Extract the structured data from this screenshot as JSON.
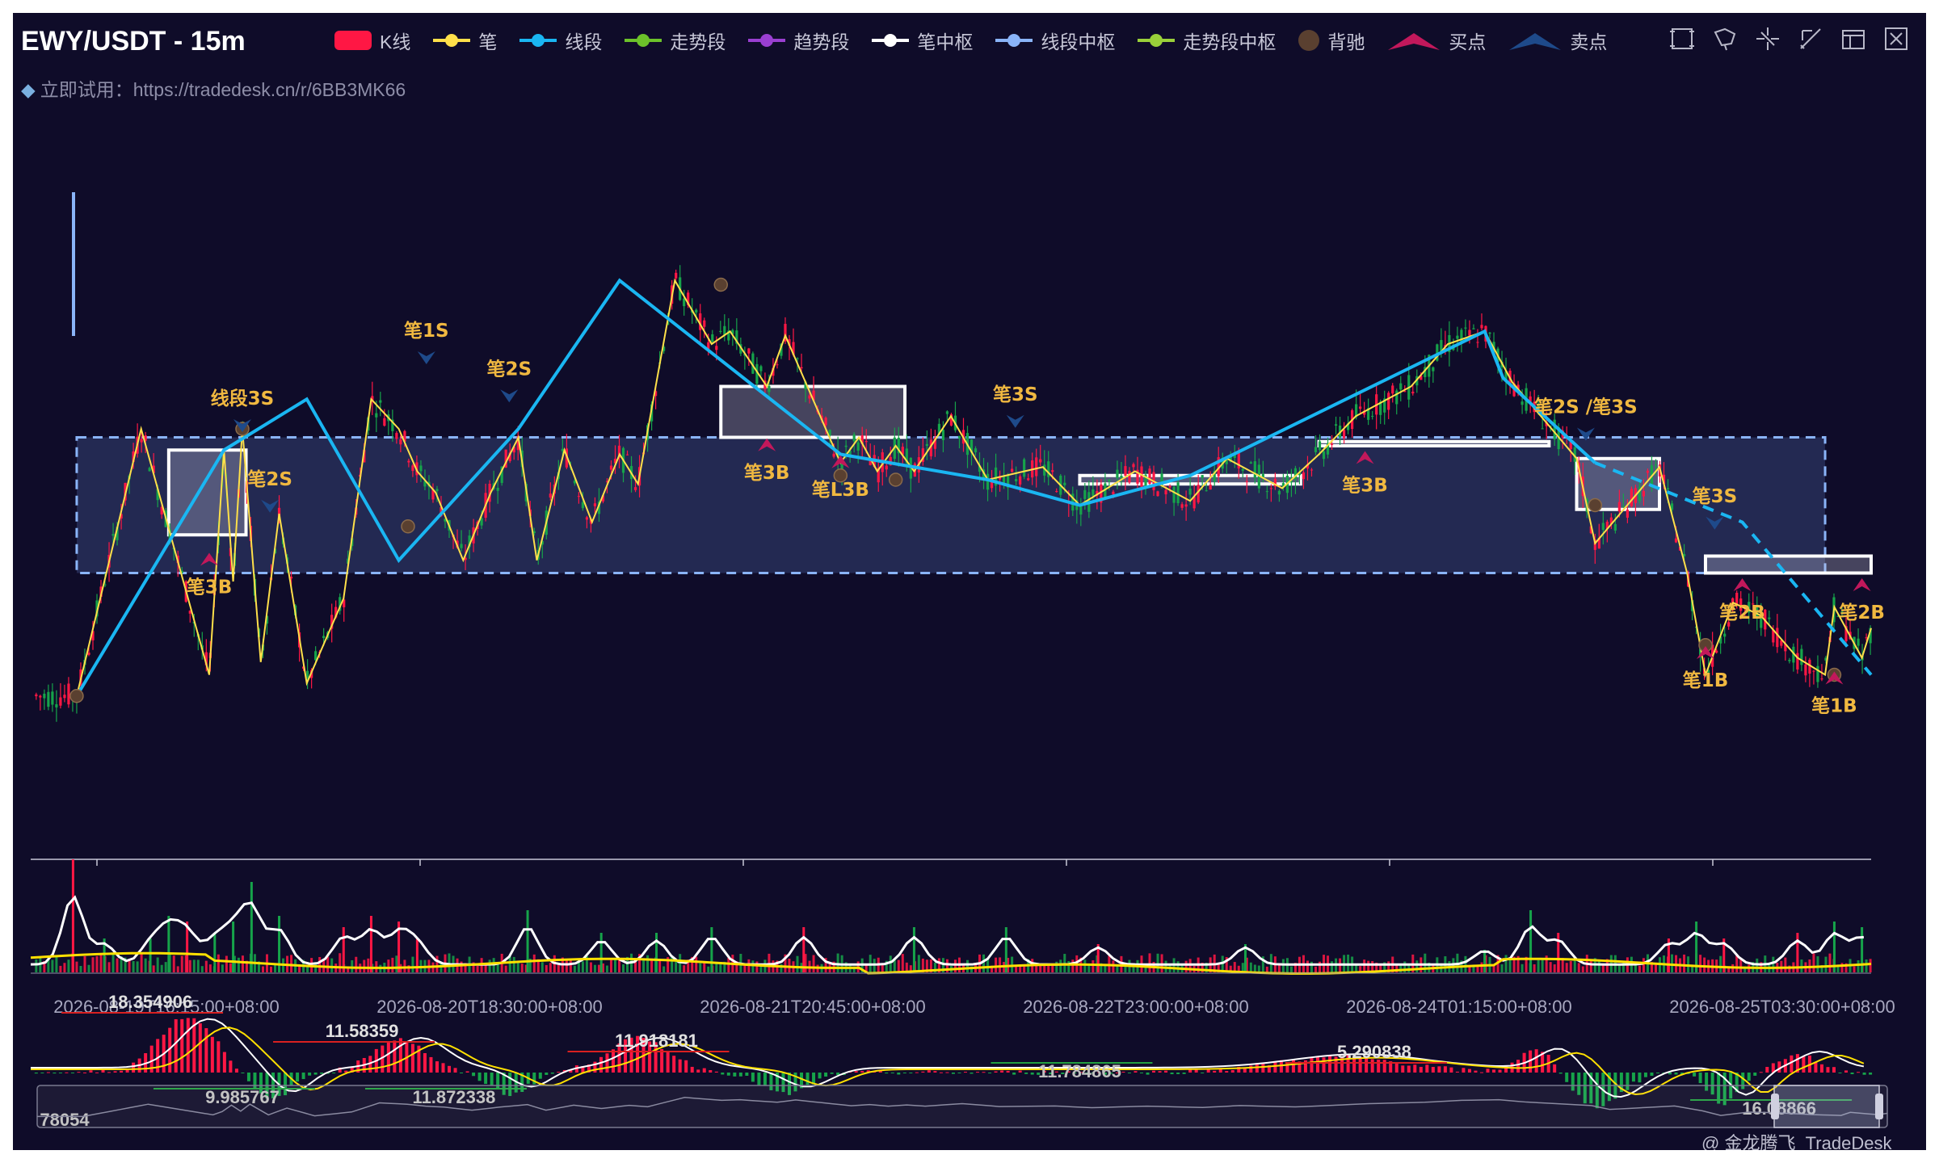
{
  "title": "EWY/USDT - 15m",
  "subtitle": "立即试用：https://tradedesk.cn/r/6BB3MK66",
  "legend": [
    {
      "label": "K线",
      "icon": "kline-legend-icon",
      "color": "#ff1744"
    },
    {
      "label": "笔",
      "icon": "line-legend-icon",
      "color": "#ffe04a"
    },
    {
      "label": "线段",
      "icon": "line-legend-icon",
      "color": "#1ab6f2"
    },
    {
      "label": "走势段",
      "icon": "line-legend-icon",
      "color": "#6cc22a"
    },
    {
      "label": "趋势段",
      "icon": "line-legend-icon",
      "color": "#9a3fd1"
    },
    {
      "label": "笔中枢",
      "icon": "line-legend-icon",
      "color": "#ffffff"
    },
    {
      "label": "线段中枢",
      "icon": "line-legend-icon",
      "color": "#8ab4f8"
    },
    {
      "label": "走势段中枢",
      "icon": "line-legend-icon",
      "color": "#9ad03a"
    },
    {
      "label": "背驰",
      "icon": "circle-legend-icon",
      "color": "#5a4030"
    },
    {
      "label": "买点",
      "icon": "triangle-legend-icon",
      "color": "#c2185b"
    },
    {
      "label": "卖点",
      "icon": "triangle-legend-icon",
      "color": "#1e4a8a"
    }
  ],
  "toolbox": [
    "zoom-rect-icon",
    "lasso-icon",
    "zoom-reset-icon",
    "brush-icon",
    "data-view-icon",
    "clear-icon"
  ],
  "watermark": "@ 金龙腾飞_TradeDesk",
  "colors": {
    "up": "#ff1744",
    "down": "#16a34a",
    "bi": "#ffe04a",
    "seg": "#1ab6f2",
    "zs": "#ffffff",
    "segzs": "#8ab4f8",
    "buy": "#c2185b",
    "sell": "#1e4a8a",
    "div": "#5a4030"
  },
  "chart_data": [
    {
      "type": "candlestick",
      "x_ticks": [
        "2026-08-19T16:15:00+08:00",
        "2026-08-20T18:30:00+08:00",
        "2026-08-21T20:45:00+08:00",
        "2026-08-22T23:00:00+08:00",
        "2026-08-24T01:15:00+08:00",
        "2026-08-25T03:30:00+08:00"
      ],
      "x_range": [
        0,
        100
      ],
      "y_range": [
        5,
        21
      ],
      "bi": [
        [
          2.5,
          8.7
        ],
        [
          6,
          15
        ],
        [
          9.7,
          9.2
        ],
        [
          10.5,
          14.5
        ],
        [
          11,
          11.4
        ],
        [
          11.5,
          15
        ],
        [
          12.5,
          9.5
        ],
        [
          13.5,
          13
        ],
        [
          15,
          9
        ],
        [
          17,
          11
        ],
        [
          18.5,
          15.7
        ],
        [
          20,
          15
        ],
        [
          21,
          14
        ],
        [
          22,
          13.5
        ],
        [
          23.5,
          11.9
        ],
        [
          25,
          13.5
        ],
        [
          26.5,
          14.8
        ],
        [
          27.5,
          11.9
        ],
        [
          29,
          14.5
        ],
        [
          30.5,
          12.8
        ],
        [
          32,
          14.4
        ],
        [
          33,
          13.7
        ],
        [
          35,
          18.5
        ],
        [
          37,
          17
        ],
        [
          38,
          17.3
        ],
        [
          40,
          16
        ],
        [
          41,
          17.2
        ],
        [
          42,
          16.2
        ],
        [
          44,
          14.2
        ],
        [
          45,
          14.8
        ],
        [
          46,
          14
        ],
        [
          47,
          14.6
        ],
        [
          48,
          14
        ],
        [
          50,
          15.3
        ],
        [
          52,
          13.8
        ],
        [
          55,
          14.1
        ],
        [
          57,
          13.2
        ],
        [
          60,
          14
        ],
        [
          63,
          13.3
        ],
        [
          65,
          14.3
        ],
        [
          68,
          13.6
        ],
        [
          70,
          14.4
        ],
        [
          72,
          15.3
        ],
        [
          75,
          16
        ],
        [
          77,
          17
        ],
        [
          79,
          17.3
        ],
        [
          80.5,
          16.1
        ],
        [
          84,
          14.3
        ],
        [
          85,
          12.3
        ],
        [
          88.5,
          14.1
        ],
        [
          90,
          11.6
        ],
        [
          91,
          9.2
        ],
        [
          92.5,
          10.9
        ],
        [
          94,
          10.6
        ],
        [
          96,
          9.6
        ],
        [
          97.5,
          9.2
        ],
        [
          98,
          10.8
        ],
        [
          99.5,
          9.6
        ],
        [
          100,
          10.3
        ]
      ],
      "seg": [
        [
          2.5,
          8.7
        ],
        [
          10.5,
          14.5
        ],
        [
          15,
          15.7
        ],
        [
          20,
          11.9
        ],
        [
          26.5,
          15
        ],
        [
          32,
          18.5
        ],
        [
          44,
          14.4
        ],
        [
          52,
          13.8
        ],
        [
          57,
          13.2
        ],
        [
          63,
          13.9
        ],
        [
          79,
          17.3
        ],
        [
          80,
          16.2
        ],
        [
          85,
          14.2
        ],
        [
          93,
          12.8
        ],
        [
          100,
          9.2
        ]
      ],
      "bi_zs": [
        [
          7.5,
          11.7,
          12.5,
          14.5
        ],
        [
          37.5,
          47.5,
          14.8,
          16.0
        ],
        [
          57,
          69,
          13.7,
          13.9
        ],
        [
          70,
          82.5,
          14.6,
          14.7
        ],
        [
          84,
          88.5,
          13.1,
          14.3
        ],
        [
          91,
          100,
          11.6,
          12.0
        ]
      ],
      "seg_zs": [
        [
          2.5,
          97.5,
          11.6,
          14.8
        ]
      ],
      "divergence": [
        [
          2.5,
          8.7
        ],
        [
          11.5,
          15.0
        ],
        [
          20.5,
          12.7
        ],
        [
          37.5,
          18.4
        ],
        [
          44,
          13.9
        ],
        [
          47,
          13.8
        ],
        [
          85,
          13.2
        ],
        [
          91,
          9.9
        ],
        [
          98,
          9.2
        ]
      ],
      "signals": [
        {
          "x": 9.7,
          "y": 12.0,
          "label": "笔3B",
          "kind": "buy"
        },
        {
          "x": 11.5,
          "y": 15.0,
          "label": "线段3S",
          "kind": "sell"
        },
        {
          "x": 13,
          "y": 13.1,
          "label": "笔2S",
          "kind": "sell"
        },
        {
          "x": 21.5,
          "y": 16.6,
          "label": "笔1S",
          "kind": "sell"
        },
        {
          "x": 26,
          "y": 15.7,
          "label": "笔2S",
          "kind": "sell"
        },
        {
          "x": 40,
          "y": 14.7,
          "label": "笔3B",
          "kind": "buy"
        },
        {
          "x": 44,
          "y": 14.3,
          "label": "笔L3B",
          "kind": "buy"
        },
        {
          "x": 53.5,
          "y": 15.1,
          "label": "笔3S",
          "kind": "sell"
        },
        {
          "x": 72.5,
          "y": 14.4,
          "label": "笔3B",
          "kind": "buy"
        },
        {
          "x": 84.5,
          "y": 14.8,
          "label": "笔2S /笔3S",
          "kind": "sell"
        },
        {
          "x": 91.5,
          "y": 12.7,
          "label": "笔3S",
          "kind": "sell"
        },
        {
          "x": 93,
          "y": 11.4,
          "label": "笔2B",
          "kind": "buy"
        },
        {
          "x": 91,
          "y": 9.8,
          "label": "笔1B",
          "kind": "buy"
        },
        {
          "x": 99.5,
          "y": 11.4,
          "label": "笔2B",
          "kind": "buy"
        },
        {
          "x": 98,
          "y": 9.2,
          "label": "笔1B",
          "kind": "buy"
        }
      ]
    },
    {
      "type": "bar",
      "name": "volume",
      "spikes": [
        [
          2.3,
          1.0
        ],
        [
          4,
          0.3
        ],
        [
          6.5,
          0.3
        ],
        [
          7.5,
          0.5
        ],
        [
          8.5,
          0.45
        ],
        [
          10,
          0.35
        ],
        [
          11,
          0.45
        ],
        [
          12,
          0.8
        ],
        [
          13.5,
          0.5
        ],
        [
          17,
          0.4
        ],
        [
          18.5,
          0.5
        ],
        [
          20,
          0.45
        ],
        [
          21,
          0.3
        ],
        [
          27,
          0.55
        ],
        [
          31,
          0.35
        ],
        [
          34,
          0.35
        ],
        [
          37,
          0.4
        ],
        [
          42,
          0.4
        ],
        [
          48,
          0.4
        ],
        [
          53,
          0.4
        ],
        [
          58,
          0.25
        ],
        [
          66,
          0.25
        ],
        [
          79,
          0.2
        ],
        [
          81.5,
          0.55
        ],
        [
          83,
          0.35
        ],
        [
          89,
          0.3
        ],
        [
          90.5,
          0.45
        ],
        [
          92,
          0.3
        ],
        [
          96,
          0.35
        ],
        [
          98,
          0.45
        ],
        [
          99.5,
          0.4
        ]
      ]
    },
    {
      "type": "line",
      "name": "macd",
      "labels": [
        {
          "x": 6.5,
          "text": "18.354906",
          "color": "#e0e0e0"
        },
        {
          "x": 18,
          "text": "11.58359",
          "color": "#e0e0e0"
        },
        {
          "x": 34,
          "text": "11.918181",
          "color": "#e0e0e0"
        },
        {
          "x": 73,
          "text": "5.290838",
          "color": "#e0e0e0"
        },
        {
          "x": 11.5,
          "text": "9.985767",
          "color": "#c0c0c0"
        },
        {
          "x": 23,
          "text": "11.872338",
          "color": "#c0c0c0"
        },
        {
          "x": 57,
          "text": "11.784865",
          "color": "#c0c0c0"
        },
        {
          "x": 95,
          "text": "16.08866",
          "color": "#c0c0c0"
        },
        {
          "x": 0.5,
          "text": "78054",
          "color": "#c0c0c0"
        }
      ]
    }
  ]
}
